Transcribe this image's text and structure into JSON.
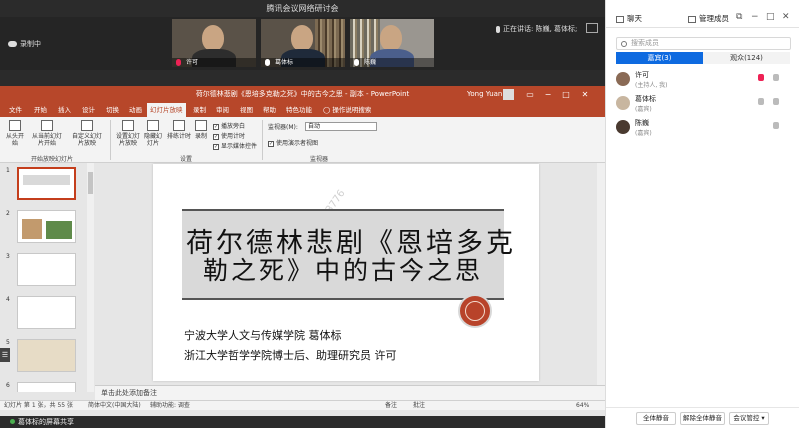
{
  "app_title": "腾讯会议网络研讨会",
  "recording": {
    "label": "录制中"
  },
  "speaking": {
    "label": "正在讲话:",
    "names": "陈巍, 葛体标;"
  },
  "videos": [
    {
      "name": "许可",
      "muted": true
    },
    {
      "name": "葛体标",
      "muted": false
    },
    {
      "name": "陈巍",
      "muted": false
    }
  ],
  "ppt": {
    "window_title": "荷尔德林悲剧《恩培多克勒之死》中的古今之思 - 副本 - PowerPoint",
    "user": "Yong Yuan",
    "tabs": [
      "文件",
      "开始",
      "插入",
      "设计",
      "切换",
      "动画",
      "幻灯片放映",
      "录制",
      "审阅",
      "视图",
      "帮助",
      "特色功能",
      "操作说明搜索"
    ],
    "active_tab": "幻灯片放映",
    "ribbon": {
      "from_start": "从头开始",
      "from_current": "从当前幻灯片开始",
      "custom": "自定义幻灯片放映",
      "group_start": "开始放映幻灯片",
      "setup": "设置幻灯片放映",
      "hide": "隐藏幻灯片",
      "rehearse": "排练计时",
      "record": "录制",
      "play_narration": "播放旁白",
      "use_timings": "使用计时",
      "show_media": "显示媒体控件",
      "group_setup": "设置",
      "monitor_label": "监视器(M):",
      "monitor_value": "自动",
      "presenter_view": "使用演示者视图",
      "group_monitors": "监视器"
    },
    "slide_numbers": [
      "1",
      "2",
      "3",
      "4",
      "5",
      "6"
    ],
    "slide": {
      "title_line1": "荷尔德林悲剧《恩培多克",
      "title_line2": "勒之死》中的古今之思",
      "author1": "宁波大学人文与传媒学院 葛体标",
      "author2": "浙江大学哲学学院博士后、助理研究员 许可",
      "watermark": "0663776"
    },
    "notes_placeholder": "单击此处添加备注",
    "status": {
      "slide_info": "幻灯片 第 1 张，共 55 张",
      "language": "简体中文(中国大陆)",
      "accessibility": "辅助功能: 调查",
      "notes": "备注",
      "comments": "批注",
      "zoom": "64%"
    }
  },
  "share_bar": {
    "label": "葛体标的屏幕共享"
  },
  "panel": {
    "tab_chat": "聊天",
    "tab_members": "管理成员",
    "search_placeholder": "搜索成员",
    "seg_guests": "嘉宾(3)",
    "seg_audience": "观众(124)",
    "members": [
      {
        "name": "许可",
        "role": "(主持人, 我)",
        "avatar_color": "#8a6a55"
      },
      {
        "name": "葛体标",
        "role": "(嘉宾)",
        "avatar_color": "#c8b6a0"
      },
      {
        "name": "陈巍",
        "role": "(嘉宾)",
        "avatar_color": "#4a3a30"
      }
    ],
    "btn_mute_all": "全体静音",
    "btn_unmute_all": "解除全体静音",
    "btn_control": "会议管控"
  },
  "colors": {
    "ppt_accent": "#b7472a",
    "segment_active": "#0e6ae0",
    "seal": "#b8432a"
  }
}
